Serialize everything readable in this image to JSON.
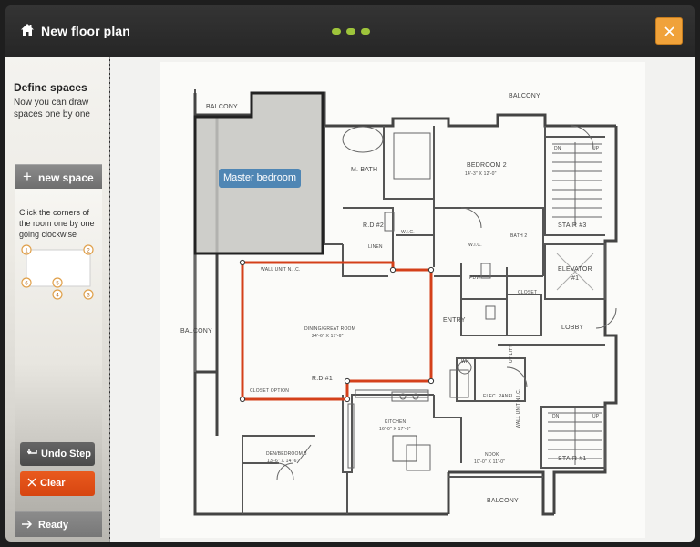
{
  "header": {
    "title": "New floor plan",
    "steps": 3,
    "close_label": "×"
  },
  "sidebar": {
    "title": "Define spaces",
    "subtitle": "Now you can draw spaces one by one",
    "new_space_label": "new space",
    "hint": "Click the corners of the room one by one going clockwise",
    "corner_numbers": [
      "1",
      "2",
      "3",
      "4",
      "5",
      "6"
    ],
    "undo_label": "Undo Step",
    "clear_label": "Clear",
    "ready_label": "Ready"
  },
  "plan": {
    "space_label": "Master bedroom",
    "rooms": {
      "balcony_top_left": "BALCONY",
      "balcony_top_right": "BALCONY",
      "balcony_left": "BALCONY",
      "balcony_bottom": "BALCONY",
      "m_bath": "M. BATH",
      "bedroom2": "BEDROOM 2",
      "bedroom2_dims": "14'-3\" X 12'-0\"",
      "rd2": "R.D #2",
      "wic_left": "W.I.C.",
      "wic_right": "W.I.C.",
      "linen": "LINEN",
      "bath2": "BATH 2",
      "pdw": "PDW",
      "closet": "CLOSET",
      "elevator": "ELEVATOR",
      "elevator_num": "#1",
      "lobby": "LOBBY",
      "stair3": "STAIR #3",
      "stair1": "STAIR #1",
      "wall_unit_top": "WALL UNIT N.I.C.",
      "wall_unit_right": "WALL UNIT N.I.C.",
      "dining": "DINING/GREAT ROOM",
      "dining_dims": "24'-6\" X 17'-6\"",
      "entry": "ENTRY",
      "rd1": "R.D #1",
      "closet_option": "CLOSET OPTION",
      "utility": "UTILITY",
      "wh": "WH",
      "elec_panel": "ELEC. PANEL",
      "kitchen": "KITCHEN",
      "kitchen_dims": "16'-0\" X 17'-6\"",
      "den": "DEN/BEDROOM 3",
      "den_dims": "13'-6\" X 14'-6\"",
      "nook": "NOOK",
      "nook_dims": "10'-0\" X 11'-0\"",
      "dn": "DN",
      "up": "UP"
    }
  },
  "colors": {
    "accent_green": "#9ec43b",
    "close_orange": "#f0a23a",
    "clear_red": "#e04d15",
    "space_blue": "#4f86b4",
    "outline_red": "#d4401a"
  }
}
